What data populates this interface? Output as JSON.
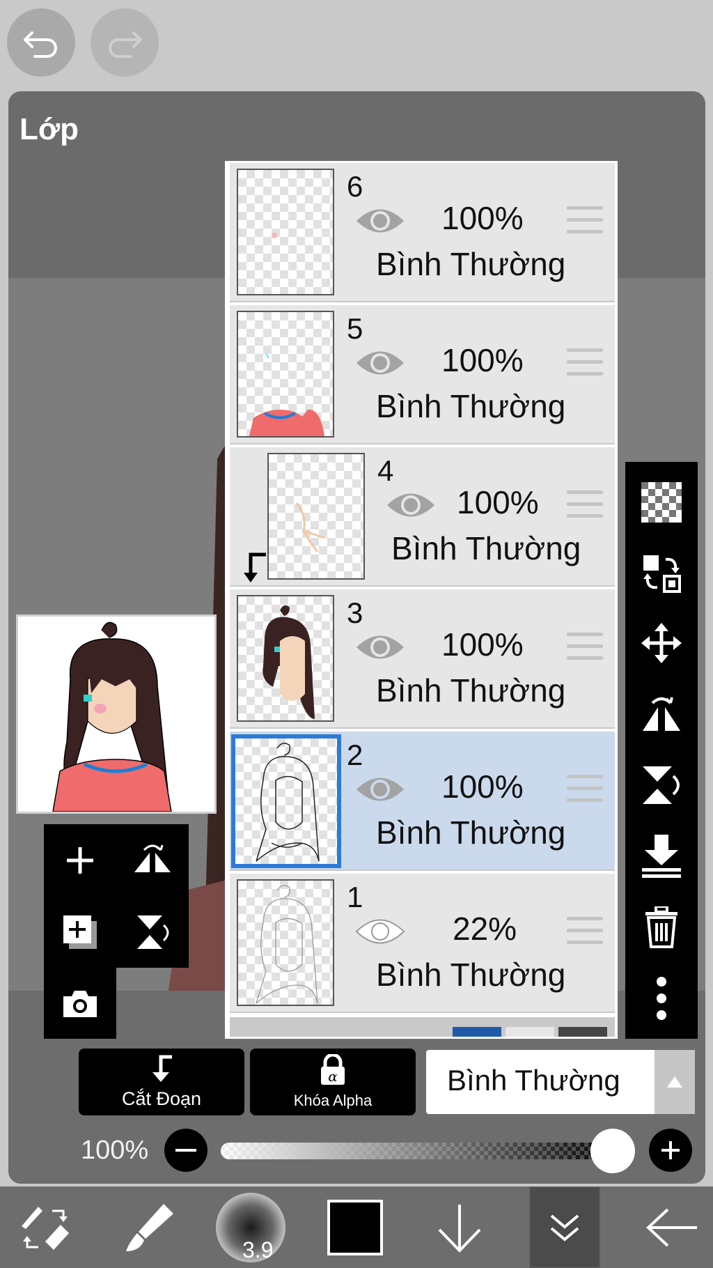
{
  "top": {
    "undo": "undo-icon",
    "redo": "redo-icon"
  },
  "panel": {
    "title": "Lớp"
  },
  "layers": [
    {
      "number": "6",
      "opacity": "100%",
      "blend": "Bình Thường",
      "visible": true,
      "clipped": false,
      "selected": false
    },
    {
      "number": "5",
      "opacity": "100%",
      "blend": "Bình Thường",
      "visible": true,
      "clipped": false,
      "selected": false
    },
    {
      "number": "4",
      "opacity": "100%",
      "blend": "Bình Thường",
      "visible": true,
      "clipped": true,
      "selected": false
    },
    {
      "number": "3",
      "opacity": "100%",
      "blend": "Bình Thường",
      "visible": true,
      "clipped": false,
      "selected": false
    },
    {
      "number": "2",
      "opacity": "100%",
      "blend": "Bình Thường",
      "visible": true,
      "clipped": false,
      "selected": true
    },
    {
      "number": "1",
      "opacity": "22%",
      "blend": "Bình Thường",
      "visible": true,
      "clipped": false,
      "selected": false
    }
  ],
  "actions": {
    "clip_label": "Cắt Đoạn",
    "alpha_lock_label": "Khóa Alpha",
    "blend_mode": "Bình Thường"
  },
  "opacity": {
    "label": "100%",
    "value_percent": 100
  },
  "bottom": {
    "brush_size": "3.9",
    "color": "#000000"
  },
  "colors": {
    "selected_row": "#cbd9ec",
    "selected_border": "#2e7ad8",
    "toolbar": "#000000"
  }
}
